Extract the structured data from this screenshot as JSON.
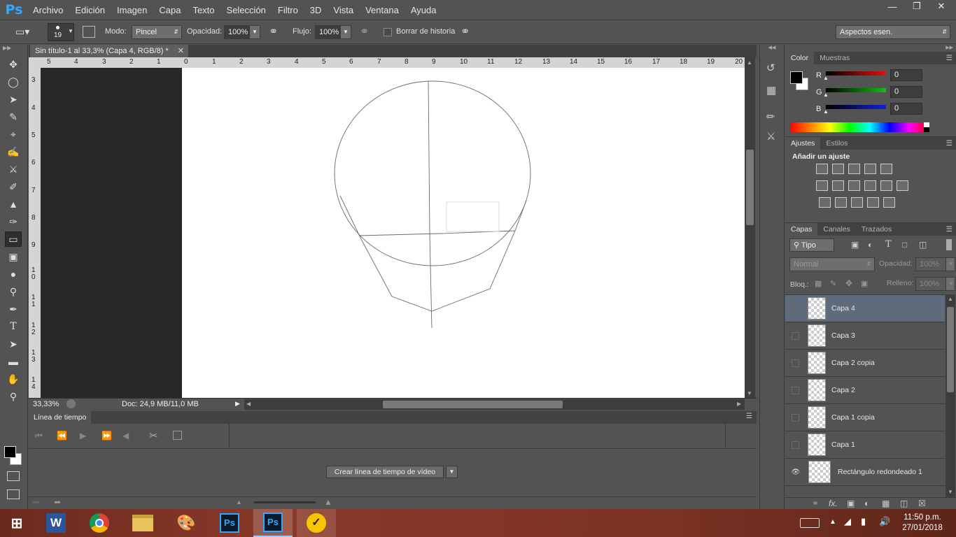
{
  "app": {
    "logo": "Ps"
  },
  "menu": [
    "Archivo",
    "Edición",
    "Imagen",
    "Capa",
    "Texto",
    "Selección",
    "Filtro",
    "3D",
    "Vista",
    "Ventana",
    "Ayuda"
  ],
  "options": {
    "brush_size": "19",
    "mode_label": "Modo:",
    "mode_value": "Pincel",
    "opacity_label": "Opacidad:",
    "opacity_value": "100%",
    "flow_label": "Flujo:",
    "flow_value": "100%",
    "erase_history_label": "Borrar de historia",
    "workspace": "Aspectos esen."
  },
  "document": {
    "tab_title": "Sin título-1 al 33,3% (Capa 4, RGB/8) *",
    "zoom": "33,33%",
    "doc_info": "Doc: 24,9 MB/11,0 MB"
  },
  "ruler_h": [
    "5",
    "4",
    "3",
    "2",
    "1",
    "0",
    "1",
    "2",
    "3",
    "4",
    "5",
    "6",
    "7",
    "8",
    "9",
    "10",
    "11",
    "12",
    "13",
    "14",
    "15",
    "16",
    "17",
    "18",
    "19",
    "20"
  ],
  "ruler_v": [
    "3",
    "4",
    "5",
    "6",
    "7",
    "8",
    "9",
    "1 0",
    "1 1",
    "1 2",
    "1 3",
    "1 4"
  ],
  "timeline": {
    "title": "Línea de tiempo",
    "create_button": "Crear línea de tiempo de vídeo"
  },
  "color_panel": {
    "tabs": [
      "Color",
      "Muestras"
    ],
    "channels": [
      {
        "label": "R",
        "value": "0",
        "color": "#e01010"
      },
      {
        "label": "G",
        "value": "0",
        "color": "#10c010"
      },
      {
        "label": "B",
        "value": "0",
        "color": "#1020e0"
      }
    ]
  },
  "adjust_panel": {
    "tabs": [
      "Ajustes",
      "Estilos"
    ],
    "title": "Añadir un ajuste"
  },
  "layers_panel": {
    "tabs": [
      "Capas",
      "Canales",
      "Trazados"
    ],
    "filter": "Tipo",
    "blend_mode": "Normal",
    "opacity_label": "Opacidad:",
    "opacity_value": "100%",
    "lock_label": "Bloq.:",
    "fill_label": "Relleno:",
    "fill_value": "100%",
    "layers": [
      {
        "name": "Capa 4",
        "selected": true,
        "visible": false
      },
      {
        "name": "Capa 3",
        "selected": false,
        "visible": false
      },
      {
        "name": "Capa 2 copia",
        "selected": false,
        "visible": false
      },
      {
        "name": "Capa 2",
        "selected": false,
        "visible": false
      },
      {
        "name": "Capa 1 copia",
        "selected": false,
        "visible": false
      },
      {
        "name": "Capa 1",
        "selected": false,
        "visible": false
      },
      {
        "name": "Rectángulo redondeado 1",
        "selected": false,
        "visible": true
      }
    ]
  },
  "taskbar": {
    "apps": [
      "word-icon",
      "chrome-icon",
      "file-explorer-icon",
      "paint-icon",
      "photoshop-icon",
      "photoshop-icon",
      "norton-icon"
    ],
    "time": "11:50 p.m.",
    "date": "27/01/2018"
  }
}
